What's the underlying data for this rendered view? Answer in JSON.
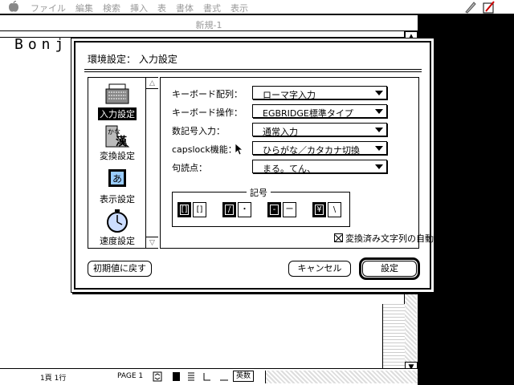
{
  "menubar": {
    "items": [
      "ファイル",
      "編集",
      "検索",
      "挿入",
      "表",
      "書体",
      "書式",
      "表示"
    ]
  },
  "document": {
    "title": "新規-1",
    "text": "Bonj"
  },
  "statusbar": {
    "position": "1頁 1行",
    "page": "PAGE 1",
    "std_button": "英数"
  },
  "dialog": {
    "title": "環境設定： 入力設定",
    "categories": [
      {
        "label": "入力設定",
        "icon": "keyboard-icon",
        "selected": true
      },
      {
        "label": "変換設定",
        "icon": "kana-kanji-icon",
        "selected": false
      },
      {
        "label": "表示設定",
        "icon": "display-a-icon",
        "selected": false
      },
      {
        "label": "速度設定",
        "icon": "stopwatch-icon",
        "selected": false
      }
    ],
    "settings": [
      {
        "label": "キーボード配列：",
        "value": "ローマ字入力"
      },
      {
        "label": "キーボード操作：",
        "value": "EGBRIDGE標準タイプ"
      },
      {
        "label": "数記号入力：",
        "value": "通常入力"
      },
      {
        "label": "capslock機能：",
        "value": "ひらがな／カタカナ切換"
      },
      {
        "label": "句読点：",
        "value": "まる。てん、"
      }
    ],
    "kigo": {
      "title": "記号",
      "pairs": [
        [
          {
            "glyph": "[]",
            "on": true
          },
          {
            "glyph": "[]",
            "on": false
          }
        ],
        [
          {
            "glyph": "/",
            "on": true
          },
          {
            "glyph": "・",
            "on": false
          }
        ],
        [
          {
            "glyph": "-",
            "on": true
          },
          {
            "glyph": "ー",
            "on": false
          }
        ],
        [
          {
            "glyph": "¥",
            "on": true
          },
          {
            "glyph": "\\",
            "on": false
          }
        ]
      ]
    },
    "auto_confirm": {
      "label": "変換済み文字列の自動確定",
      "checked": true
    },
    "buttons": {
      "reset": "初期値に戻す",
      "cancel": "キャンセル",
      "ok": "設定"
    }
  }
}
